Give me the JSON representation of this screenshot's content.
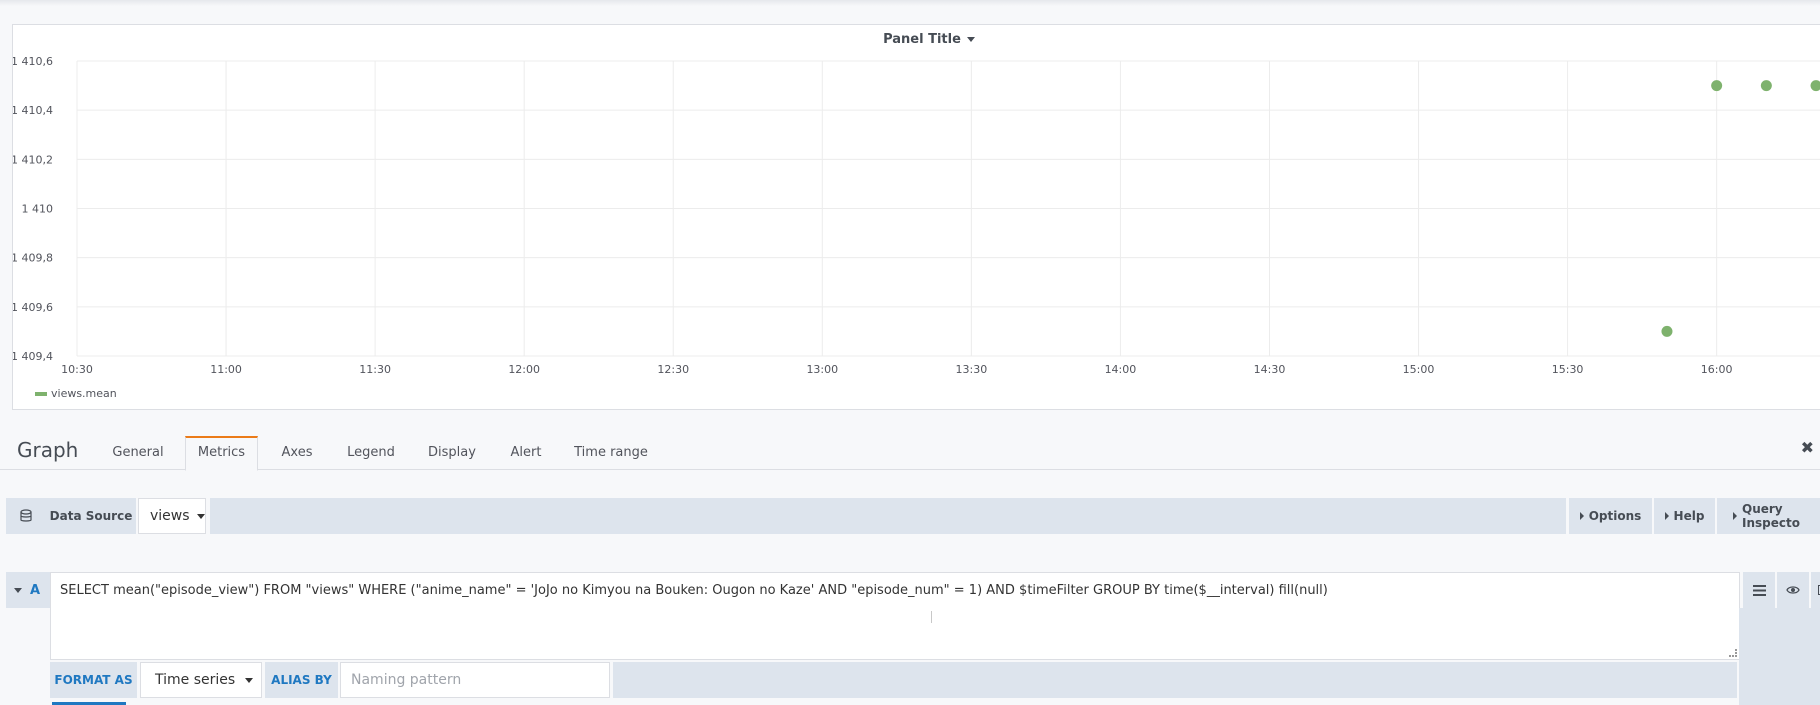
{
  "panel": {
    "title": "Panel Title"
  },
  "chart_data": {
    "type": "scatter",
    "title": "",
    "xlabel": "",
    "ylabel": "",
    "y_tick_labels": [
      "1 410,6",
      "1 410,4",
      "1 410,2",
      "1 410",
      "1 409,8",
      "1 409,6",
      "1 409,4"
    ],
    "y_ticks": [
      1410.6,
      1410.4,
      1410.2,
      1410.0,
      1409.8,
      1409.6,
      1409.4
    ],
    "ylim": [
      1409.4,
      1410.6
    ],
    "x_tick_labels": [
      "10:30",
      "11:00",
      "11:30",
      "12:00",
      "12:30",
      "13:00",
      "13:30",
      "14:00",
      "14:30",
      "15:00",
      "15:30",
      "16:00"
    ],
    "xlim": [
      "10:30",
      "16:21"
    ],
    "grid": true,
    "legend_position": "bottom-left",
    "series": [
      {
        "name": "views.mean",
        "color": "#7eb26d",
        "x": [
          "15:50",
          "16:00",
          "16:10",
          "16:20"
        ],
        "y": [
          1409.5,
          1410.5,
          1410.5,
          1410.5
        ]
      }
    ]
  },
  "editor": {
    "title": "Graph",
    "tabs": [
      {
        "label": "General",
        "active": false
      },
      {
        "label": "Metrics",
        "active": true
      },
      {
        "label": "Axes",
        "active": false
      },
      {
        "label": "Legend",
        "active": false
      },
      {
        "label": "Display",
        "active": false
      },
      {
        "label": "Alert",
        "active": false
      },
      {
        "label": "Time range",
        "active": false
      }
    ],
    "close_symbol": "✖"
  },
  "datasource": {
    "label": "Data Source",
    "value": "views",
    "options_label": "Options",
    "help_label": "Help",
    "inspector_label": "Query Inspecto"
  },
  "query": {
    "ref_id": "A",
    "text": "SELECT mean(\"episode_view\") FROM \"views\" WHERE (\"anime_name\" = 'JoJo no Kimyou na Bouken: Ougon no Kaze' AND \"episode_num\" = 1) AND $timeFilter GROUP BY time($__interval) fill(null)",
    "format_label": "FORMAT AS",
    "format_value": "Time series",
    "alias_label": "ALIAS BY",
    "alias_placeholder": "Naming pattern"
  },
  "icons": {
    "database": "database-icon",
    "menu": "hamburger-icon",
    "eye": "eye-icon",
    "close": "close-icon"
  },
  "colors": {
    "series": "#7eb26d",
    "accent": "#eb7b18",
    "link_blue": "#1f78c1"
  }
}
